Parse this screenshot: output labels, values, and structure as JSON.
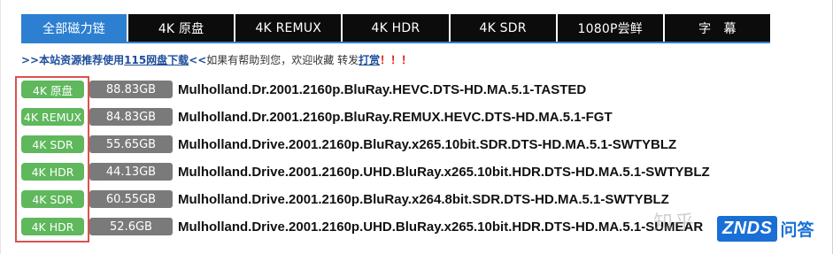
{
  "tabs": [
    {
      "label": "全部磁力链",
      "active": true
    },
    {
      "label": "4K 原盘",
      "active": false
    },
    {
      "label": "4K REMUX",
      "active": false
    },
    {
      "label": "4K HDR",
      "active": false
    },
    {
      "label": "4K SDR",
      "active": false
    },
    {
      "label": "1080P尝鲜",
      "active": false
    },
    {
      "label": "字　幕",
      "active": false
    }
  ],
  "notice": {
    "prefix": ">>本站资源推荐使用",
    "link": "115网盘下载",
    "suffix": "<<",
    "message": " 如果有帮助到您，欢迎收藏 转发 ",
    "tip": "打赏",
    "exclaim": "！！！"
  },
  "rows": [
    {
      "badge": "4K 原盘",
      "size": "88.83GB",
      "name": "Mulholland.Dr.2001.2160p.BluRay.HEVC.DTS-HD.MA.5.1-TASTED"
    },
    {
      "badge": "4K REMUX",
      "size": "84.83GB",
      "name": "Mulholland.Dr.2001.2160p.BluRay.REMUX.HEVC.DTS-HD.MA.5.1-FGT"
    },
    {
      "badge": "4K SDR",
      "size": "55.65GB",
      "name": "Mulholland.Drive.2001.2160p.BluRay.x265.10bit.SDR.DTS-HD.MA.5.1-SWTYBLZ"
    },
    {
      "badge": "4K HDR",
      "size": "44.13GB",
      "name": "Mulholland.Drive.2001.2160p.UHD.BluRay.x265.10bit.HDR.DTS-HD.MA.5.1-SWTYBLZ"
    },
    {
      "badge": "4K SDR",
      "size": "60.55GB",
      "name": "Mulholland.Drive.2001.2160p.BluRay.x264.8bit.SDR.DTS-HD.MA.5.1-SWTYBLZ"
    },
    {
      "badge": "4K HDR",
      "size": "52.6GB",
      "name": "Mulholland.Drive.2001.2160p.UHD.BluRay.x265.10bit.HDR.DTS-HD.MA.5.1-SUMEAR"
    }
  ],
  "watermarks": {
    "zhihu": "知乎",
    "znds": "ZNDS",
    "znds_cn": "问答"
  },
  "colors": {
    "active_tab": "#2d7fd1",
    "badge_green": "#5fb85c",
    "size_gray": "#7a7a7a",
    "highlight_red": "#d9534f"
  }
}
